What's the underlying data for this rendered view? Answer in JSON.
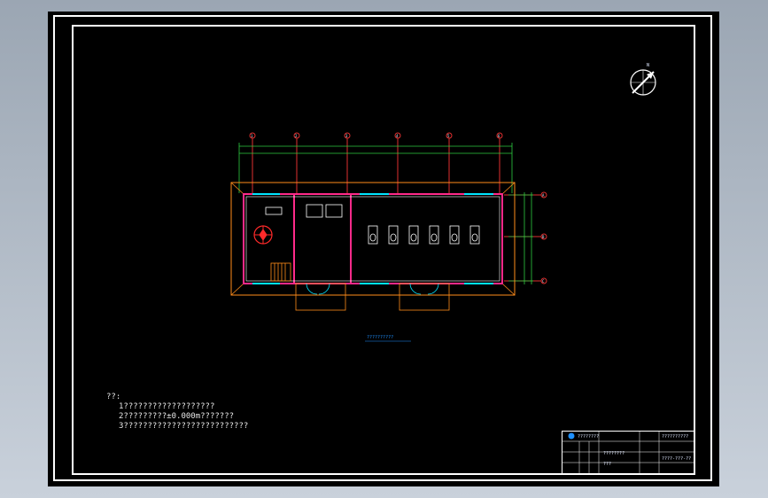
{
  "drawing": {
    "notes": {
      "title": "??:",
      "lines": [
        "1???????????????????",
        "2?????????±0.000m???????",
        "3??????????????????????????"
      ]
    },
    "plan_title": "??????????",
    "colors": {
      "background": "#000000",
      "frame": "#ffffff",
      "wall": "#ff2a8a",
      "dimension": "#2ecc40",
      "axis": "#e03030",
      "fixture": "#ffffff",
      "window": "#00e5ff",
      "annotation": "#1e90ff"
    },
    "axis_labels_top": [
      "1",
      "2",
      "3",
      "4",
      "5",
      "6"
    ],
    "axis_labels_right": [
      "A",
      "B",
      "C"
    ],
    "title_block": {
      "company": "????????",
      "project": "??????????",
      "drawing_name": "????????",
      "sheet_name": "???",
      "drawing_no": "????-???-??"
    },
    "compass": {
      "north_label": "N"
    }
  }
}
